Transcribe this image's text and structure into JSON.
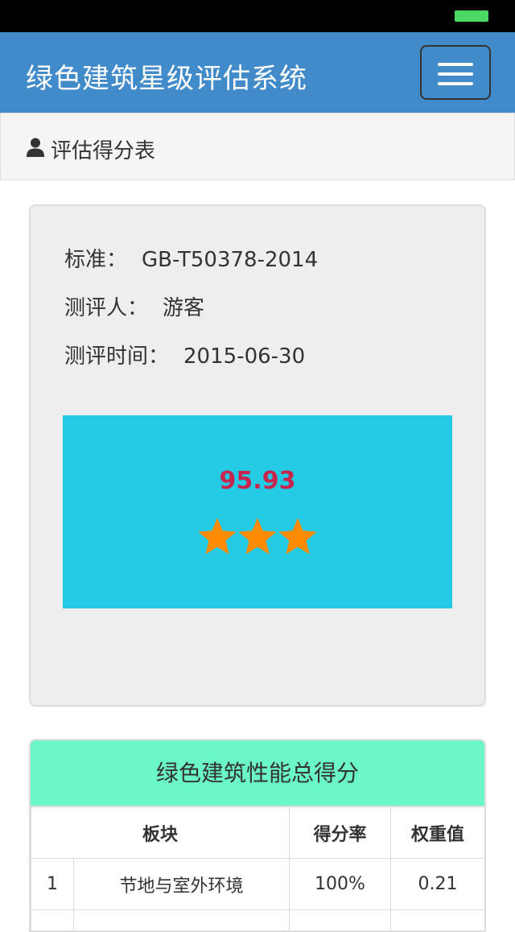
{
  "app": {
    "title": "绿色建筑星级评估系统"
  },
  "panel": {
    "heading": "评估得分表"
  },
  "info": {
    "standard_label": "标准：",
    "standard_value": "GB-T50378-2014",
    "evaluator_label": "测评人：",
    "evaluator_value": "游客",
    "time_label": "测评时间：",
    "time_value": "2015-06-30"
  },
  "score": {
    "value": "95.93",
    "stars": 3,
    "star_color": "#ff8c00"
  },
  "table": {
    "title": "绿色建筑性能总得分",
    "headers": [
      "板块",
      "得分率",
      "权重值"
    ],
    "rows": [
      {
        "index": "1",
        "section": "节地与室外环境",
        "rate": "100%",
        "weight": "0.21"
      }
    ]
  },
  "colors": {
    "navbar": "#428bca",
    "score_box": "#24c9e4",
    "table_header": "#6af7c5",
    "score_text": "#c7254e"
  }
}
